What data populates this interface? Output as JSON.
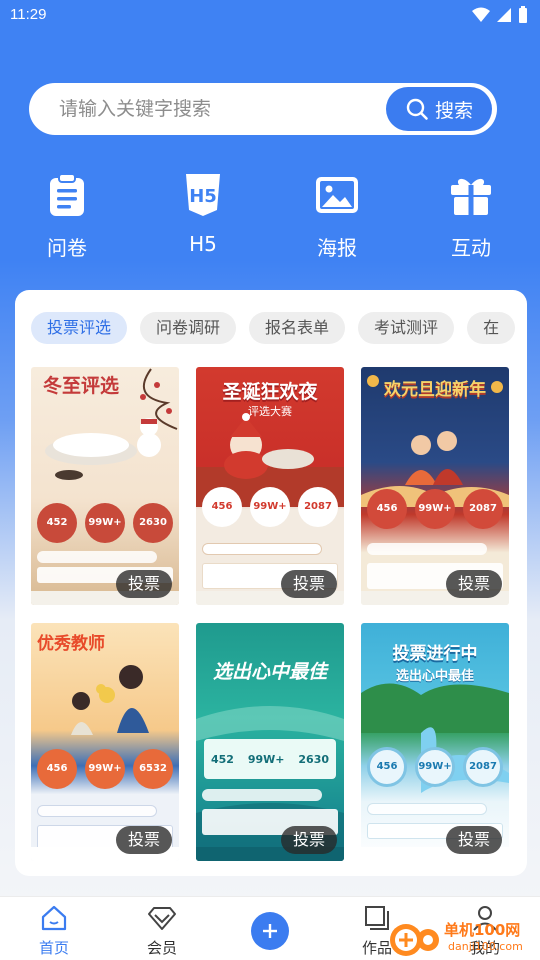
{
  "status_bar": {
    "time": "11:29"
  },
  "search": {
    "placeholder": "请输入关键字搜索",
    "button_label": "搜索"
  },
  "quick_actions": [
    {
      "label": "问卷",
      "icon": "clipboard-icon"
    },
    {
      "label": "H5",
      "icon": "h5-icon"
    },
    {
      "label": "海报",
      "icon": "image-icon"
    },
    {
      "label": "互动",
      "icon": "gift-icon"
    }
  ],
  "categories": [
    {
      "label": "投票评选",
      "active": true
    },
    {
      "label": "问卷调研",
      "active": false
    },
    {
      "label": "报名表单",
      "active": false
    },
    {
      "label": "考试测评",
      "active": false
    },
    {
      "label": "在",
      "active": false
    }
  ],
  "posters": [
    {
      "title": "冬至评选",
      "badge": "投票",
      "stats": [
        "452",
        "99W+",
        "2630"
      ],
      "theme": "winter-solstice"
    },
    {
      "title": "圣诞狂欢夜",
      "subtitle": "评选大赛",
      "badge": "投票",
      "stats": [
        "456",
        "99W+",
        "2087"
      ],
      "theme": "christmas"
    },
    {
      "title": "欢元旦迎新年",
      "badge": "投票",
      "stats": [
        "456",
        "99W+",
        "2087"
      ],
      "theme": "new-year"
    },
    {
      "title": "优秀教师",
      "badge": "投票",
      "stats": [
        "456",
        "99W+",
        "6532"
      ],
      "theme": "teacher"
    },
    {
      "title": "选出心中最佳",
      "badge": "投票",
      "stats": [
        "452",
        "99W+",
        "2630"
      ],
      "theme": "best-choice-teal"
    },
    {
      "title": "投票进行中",
      "subtitle": "选出心中最佳",
      "badge": "投票",
      "stats": [
        "456",
        "99W+",
        "2087"
      ],
      "theme": "voting-green"
    }
  ],
  "tab_bar": [
    {
      "label": "首页",
      "icon": "home-icon",
      "active": true
    },
    {
      "label": "会员",
      "icon": "diamond-icon",
      "active": false
    },
    {
      "label": "",
      "icon": "plus-icon",
      "active": false
    },
    {
      "label": "作品",
      "icon": "works-icon",
      "active": false
    },
    {
      "label": "我的",
      "icon": "person-icon",
      "active": false
    }
  ],
  "watermark": {
    "text": "单机100网",
    "url": "danji100.com"
  },
  "colors": {
    "primary": "#3b7cf0",
    "header_bg": "#3f82f3"
  }
}
